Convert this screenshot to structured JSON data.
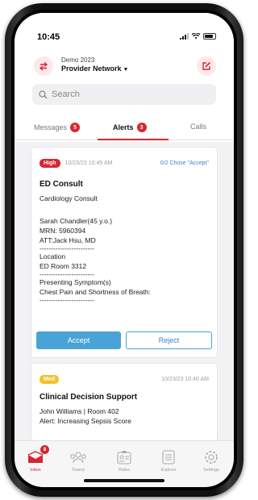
{
  "status_bar": {
    "time": "10:45"
  },
  "header": {
    "org_name": "Demo 2023",
    "network": "Provider Network",
    "search_placeholder": "Search"
  },
  "tabs": [
    {
      "label": "Messages",
      "badge": "5"
    },
    {
      "label": "Alerts",
      "badge": "3"
    },
    {
      "label": "Calls"
    }
  ],
  "alerts": [
    {
      "priority": "High",
      "timestamp": "10/23/23 10:45 AM",
      "accept_status": "0/2 Chose \"Accept\"",
      "title": "ED Consult",
      "subtitle": "Cardiology Consult",
      "patient": "Sarah Chandler(45 y.o.)",
      "mrn": "MRN: 5960394",
      "att": "ATT:Jack Hsu, MD",
      "divider": "------------------------",
      "location_label": "Location",
      "location_value": "ED Room 3312",
      "symptoms_label": "Presenting Symptom(s)",
      "symptoms_value": "Chest Pain and Shortness of Breath:",
      "accept_label": "Accept",
      "reject_label": "Reject"
    },
    {
      "priority": "Med",
      "timestamp": "10/23/23 10:40 AM",
      "title": "Clinical Decision Support",
      "line1": "John Williams | Room 402",
      "line2": "Alert: Increasing Sepsis Score"
    }
  ],
  "bottom_nav": [
    {
      "label": "Inbox",
      "badge": "8",
      "icon": "inbox-icon"
    },
    {
      "label": "Teams",
      "icon": "teams-icon"
    },
    {
      "label": "Roles",
      "icon": "roles-icon"
    },
    {
      "label": "Explore",
      "icon": "explore-icon"
    },
    {
      "label": "Settings",
      "icon": "settings-icon"
    }
  ],
  "colors": {
    "accent": "#d8262f",
    "button_blue": "#4aa3d6",
    "link_blue": "#3b82c4",
    "med": "#f4c12a"
  }
}
